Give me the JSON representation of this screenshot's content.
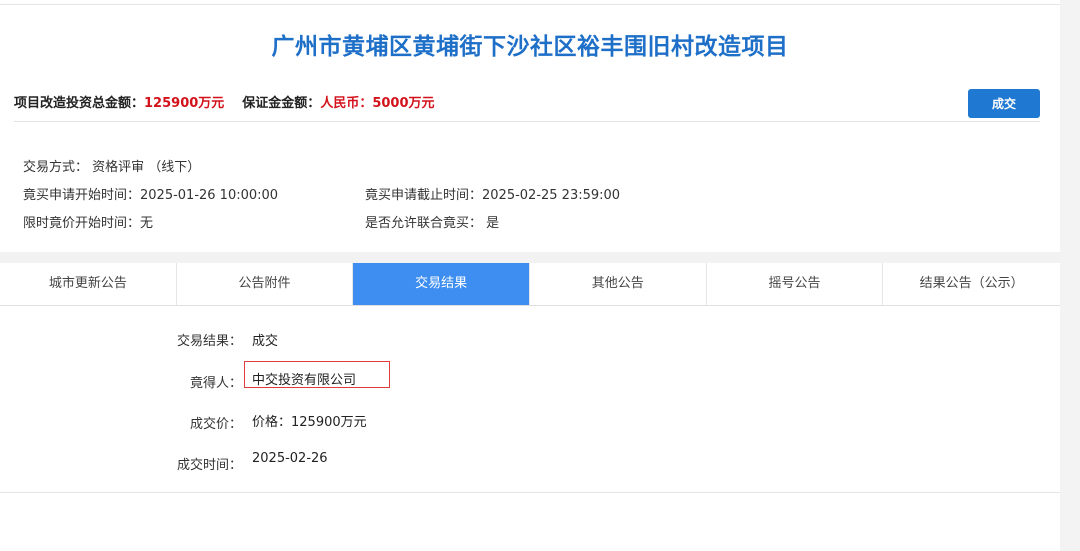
{
  "project": {
    "title": "广州市黄埔区黄埔街下沙社区裕丰围旧村改造项目",
    "invest_label": "项目改造投资总金额：",
    "invest_value": "125900万元",
    "deposit_label": "保证金金额：",
    "deposit_value": "人民币：5000万元",
    "status_button": "成交"
  },
  "info": {
    "trade_method": "交易方式：  资格评审 （线下）",
    "apply_start": "竟买申请开始时间：2025-01-26 10:00:00",
    "apply_end": "竟买申请截止时间：2025-02-25 23:59:00",
    "limit_start": "限时竟价开始时间：无",
    "joint_bid": "是否允许联合竟买：  是"
  },
  "tabs": [
    {
      "label": "城市更新公告"
    },
    {
      "label": "公告附件"
    },
    {
      "label": "交易结果"
    },
    {
      "label": "其他公告"
    },
    {
      "label": "摇号公告"
    },
    {
      "label": "结果公告（公示）"
    }
  ],
  "result": {
    "result_label": "交易结果：",
    "result_value": "成交",
    "winner_label": "竟得人：",
    "winner_value": "中交投资有限公司",
    "price_label": "成交价：",
    "price_value": "价格：125900万元",
    "time_label": "成交时间：",
    "time_value": "2025-02-26"
  },
  "colors": {
    "title_blue": "#1e6fc8",
    "amount_red": "#d4121b",
    "button_blue": "#1f78d1",
    "active_tab": "#3d8ef0",
    "highlight_red": "#e03c3c"
  }
}
